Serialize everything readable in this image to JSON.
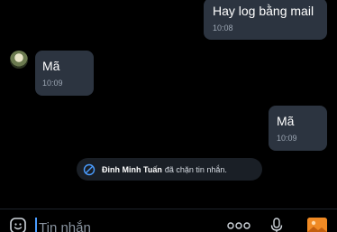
{
  "conversation": {
    "messages": [
      {
        "side": "outgoing",
        "text": "Hay log bằng mail",
        "time": "10:08"
      },
      {
        "side": "incoming",
        "text": "Mã",
        "time": "10:09"
      },
      {
        "side": "outgoing",
        "text": "Mã",
        "time": "10:09"
      }
    ],
    "system_notice": {
      "name": "Đinh Minh Tuấn",
      "text": "đã chặn tin nhắn.",
      "icon": "block-icon"
    }
  },
  "composer": {
    "placeholder": "Tin nhắn",
    "icons": [
      "emoji-icon",
      "more-icon",
      "mic-icon",
      "image-icon"
    ]
  },
  "colors": {
    "background": "#000000",
    "bubble": "#2c3440",
    "notice": "#1a1f26",
    "cursor": "#4a9cff",
    "image_button": "#f08a24"
  }
}
